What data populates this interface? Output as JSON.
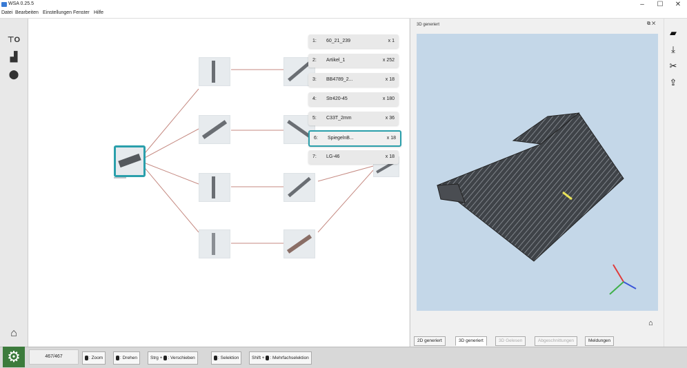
{
  "app": {
    "title": "WSA 0.25.5"
  },
  "window_controls": {
    "minimize": "–",
    "maximize": "☐",
    "close": "✕"
  },
  "menu": [
    "Datei",
    "Bearbeiten",
    "Einstellungen",
    "Fenster",
    "Hilfe"
  ],
  "left_toolbar": [
    {
      "icon": "tree-layout-icon",
      "glyph": "⊤O"
    },
    {
      "icon": "layer-icon",
      "glyph": "▟"
    },
    {
      "icon": "nest-badge-icon",
      "glyph": "⬤"
    },
    {
      "icon": "home-icon",
      "glyph": "⌂"
    }
  ],
  "article_list": [
    {
      "index": "1:",
      "name": "60_21_239",
      "count": "x 1",
      "selected": false
    },
    {
      "index": "2:",
      "name": "Artikel_1",
      "count": "x 252",
      "selected": false
    },
    {
      "index": "3:",
      "name": "BB4789_2...",
      "count": "x 18",
      "selected": false
    },
    {
      "index": "4:",
      "name": "Str420-45",
      "count": "x 180",
      "selected": false
    },
    {
      "index": "5:",
      "name": "C33T_2mm",
      "count": "x 36",
      "selected": false
    },
    {
      "index": "6:",
      "name": "SpiegelnB...",
      "count": "x 18",
      "selected": true
    },
    {
      "index": "7:",
      "name": "LG-46",
      "count": "x 18",
      "selected": false
    }
  ],
  "panel_3d": {
    "title": "3D generiert",
    "controls": "⧉ ✕",
    "tabs": [
      {
        "label": "2D generiert",
        "state": "normal"
      },
      {
        "label": "3D generiert",
        "state": "active"
      },
      {
        "label": "3D Gelesen",
        "state": "disabled"
      },
      {
        "label": "Abgeschnittungen",
        "state": "disabled"
      },
      {
        "label": "Meldungen",
        "state": "normal"
      }
    ],
    "home_glyph": "⌂"
  },
  "right_toolbar": [
    {
      "icon": "folder-icon",
      "glyph": "▰"
    },
    {
      "icon": "download-icon",
      "glyph": "⤓"
    },
    {
      "icon": "tools-icon",
      "glyph": "✂"
    },
    {
      "icon": "export-icon",
      "glyph": "⇪"
    }
  ],
  "bottom": {
    "gear_glyph": "⚙",
    "counter": "467/467",
    "hints": [
      {
        "prefix": "",
        "text": ": Zoom"
      },
      {
        "prefix": "",
        "text": ": Drehen"
      },
      {
        "prefix": "Strg + ",
        "text": ": Verschieben"
      },
      {
        "prefix": "",
        "text": ": Selektion"
      },
      {
        "prefix": "Shift + ",
        "text": ": Mehrfachselektion"
      }
    ]
  },
  "colors": {
    "accent": "#2a9fab",
    "viewport_bg": "#c4d7e8",
    "gear_bg": "#3c7b3c",
    "part_dark": "#4a4d52"
  }
}
